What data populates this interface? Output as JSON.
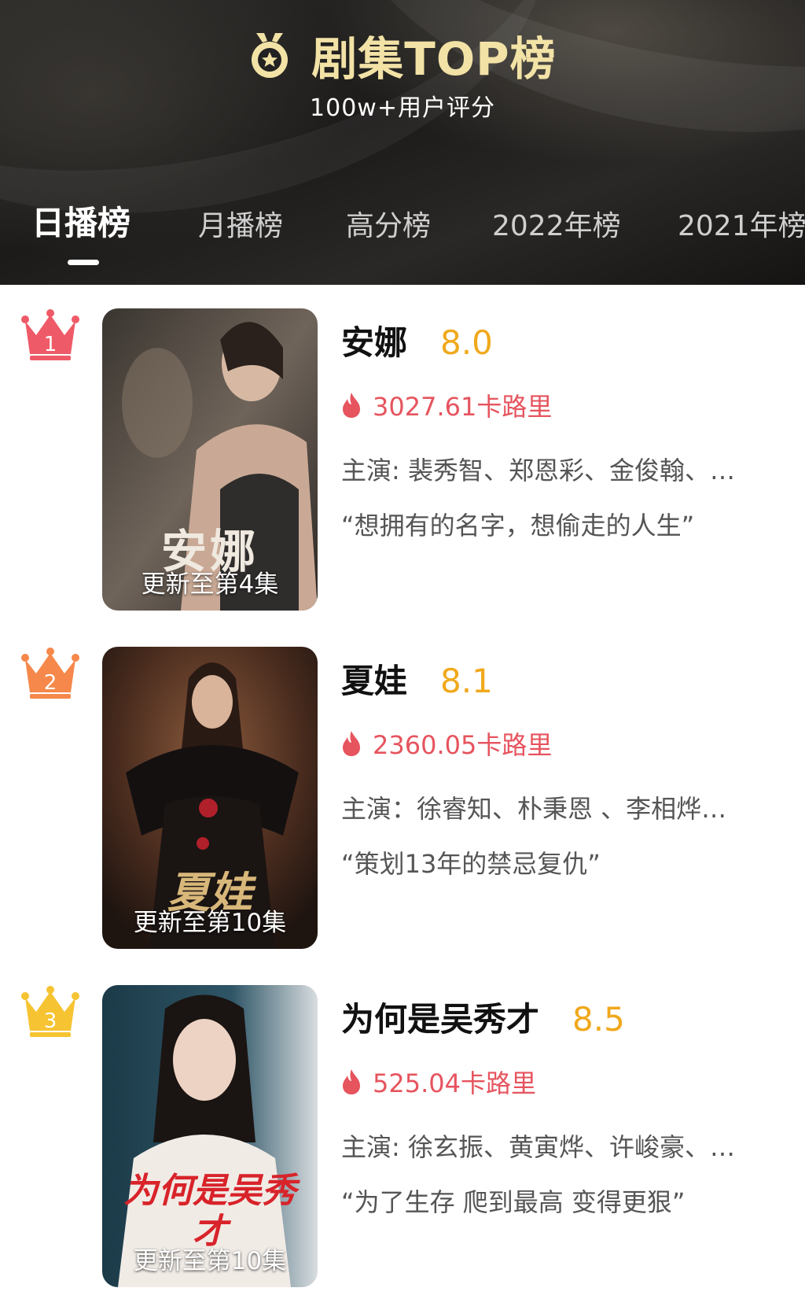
{
  "header": {
    "title": "剧集TOP榜",
    "subtitle": "100w+用户评分",
    "medal_icon": "medal-star-icon",
    "title_color": "#f2e2a6"
  },
  "tabs": [
    {
      "label": "日播榜",
      "active": true
    },
    {
      "label": "月播榜",
      "active": false
    },
    {
      "label": "高分榜",
      "active": false
    },
    {
      "label": "2022年榜",
      "active": false
    },
    {
      "label": "2021年榜",
      "active": false
    }
  ],
  "colors": {
    "score": "#f0a81c",
    "heat": "#e6545e",
    "rank1": "#ef5a68",
    "rank2": "#f5884a",
    "rank3": "#f6c332"
  },
  "items": [
    {
      "rank": "1",
      "name": "安娜",
      "score": "8.0",
      "heat": "3027.61卡路里",
      "cast": "主演: 裴秀智、郑恩彩、金俊翰、…",
      "quote": "“想拥有的名字，想偷走的人生”",
      "poster_title": "安娜",
      "episode": "更新至第4集",
      "icons": {
        "rank": "crown-icon",
        "heat": "flame-icon"
      }
    },
    {
      "rank": "2",
      "name": "夏娃",
      "score": "8.1",
      "heat": "2360.05卡路里",
      "cast": "主演：徐睿知、朴秉恩 、李相烨…",
      "quote": "“策划13年的禁忌复仇”",
      "poster_title": "夏娃",
      "episode": "更新至第10集",
      "icons": {
        "rank": "crown-icon",
        "heat": "flame-icon"
      }
    },
    {
      "rank": "3",
      "name": "为何是吴秀才",
      "score": "8.5",
      "heat": "525.04卡路里",
      "cast": "主演: 徐玄振、黄寅烨、许峻豪、…",
      "quote": "“为了生存 爬到最高 变得更狠”",
      "poster_title": "为何是吴秀才",
      "episode": "更新至第10集",
      "icons": {
        "rank": "crown-icon",
        "heat": "flame-icon"
      }
    }
  ]
}
